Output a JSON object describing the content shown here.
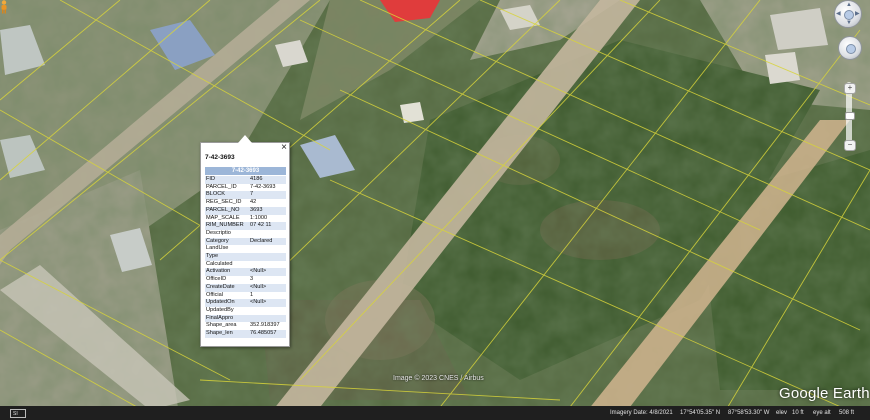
{
  "popup": {
    "title": "7-42-3693",
    "header": "7-42-3693",
    "close_glyph": "×",
    "rows": [
      {
        "key": "FID",
        "value": "4186"
      },
      {
        "key": "PARCEL_ID",
        "value": "7-42-3693"
      },
      {
        "key": "BLOCK",
        "value": "7"
      },
      {
        "key": "REG_SEC_ID",
        "value": "42"
      },
      {
        "key": "PARCEL_NO",
        "value": "3693"
      },
      {
        "key": "MAP_SCALE",
        "value": "1:1000"
      },
      {
        "key": "RIM_NUMBER",
        "value": "07 42 11"
      },
      {
        "key": "Descriptio",
        "value": ""
      },
      {
        "key": "Category",
        "value": "Declared"
      },
      {
        "key": "LandUse",
        "value": ""
      },
      {
        "key": "Type",
        "value": ""
      },
      {
        "key": "Calculated",
        "value": ""
      },
      {
        "key": "Activation",
        "value": "<Null>"
      },
      {
        "key": "OfficeID",
        "value": "3"
      },
      {
        "key": "CreateDate",
        "value": "<Null>"
      },
      {
        "key": "Official",
        "value": "1"
      },
      {
        "key": "UpdatedOn",
        "value": "<Null>"
      },
      {
        "key": "UpdatedBy",
        "value": ""
      },
      {
        "key": "FinalAppro",
        "value": ""
      },
      {
        "key": "Shape_area",
        "value": "352.918397"
      },
      {
        "key": "Shape_len",
        "value": "76.485057"
      }
    ]
  },
  "map": {
    "credit": "Image © 2023 CNES / Airbus",
    "brand": "Google Earth",
    "colors": {
      "road": "#c9b79a",
      "parcel_lines": "#d8d43a",
      "vegetation": "#4f6b3a"
    }
  },
  "status": {
    "scale_text": "SI",
    "imagery_date": "Imagery Date: 4/8/2021",
    "lat": "17°54'05.35\" N",
    "lon": "87°58'53.30\" W",
    "elev": "elev",
    "elev_val": "10 ft",
    "eye_alt": "eye alt",
    "eye_alt_val": "508 ft"
  },
  "controls": {
    "look_icon": "look-joystick-icon",
    "move_icon": "move-joystick-icon",
    "pegman_icon": "street-view-pegman-icon",
    "zoom_in": "+",
    "zoom_out": "−"
  }
}
